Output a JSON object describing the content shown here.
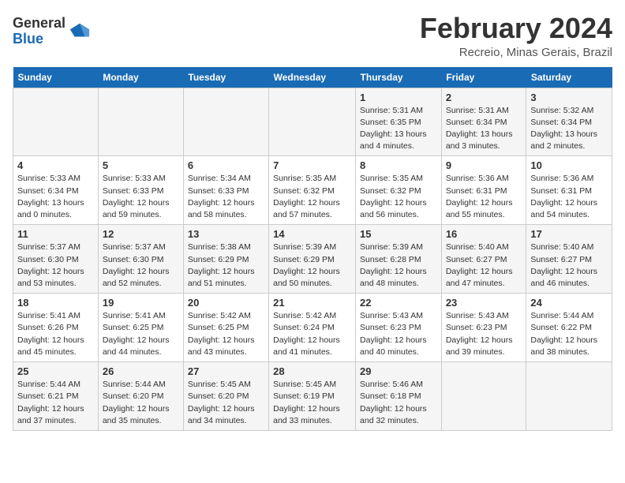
{
  "logo": {
    "general": "General",
    "blue": "Blue"
  },
  "header": {
    "month_year": "February 2024",
    "location": "Recreio, Minas Gerais, Brazil"
  },
  "days_of_week": [
    "Sunday",
    "Monday",
    "Tuesday",
    "Wednesday",
    "Thursday",
    "Friday",
    "Saturday"
  ],
  "weeks": [
    [
      {
        "day": "",
        "info": ""
      },
      {
        "day": "",
        "info": ""
      },
      {
        "day": "",
        "info": ""
      },
      {
        "day": "",
        "info": ""
      },
      {
        "day": "1",
        "info": "Sunrise: 5:31 AM\nSunset: 6:35 PM\nDaylight: 13 hours\nand 4 minutes."
      },
      {
        "day": "2",
        "info": "Sunrise: 5:31 AM\nSunset: 6:34 PM\nDaylight: 13 hours\nand 3 minutes."
      },
      {
        "day": "3",
        "info": "Sunrise: 5:32 AM\nSunset: 6:34 PM\nDaylight: 13 hours\nand 2 minutes."
      }
    ],
    [
      {
        "day": "4",
        "info": "Sunrise: 5:33 AM\nSunset: 6:34 PM\nDaylight: 13 hours\nand 0 minutes."
      },
      {
        "day": "5",
        "info": "Sunrise: 5:33 AM\nSunset: 6:33 PM\nDaylight: 12 hours\nand 59 minutes."
      },
      {
        "day": "6",
        "info": "Sunrise: 5:34 AM\nSunset: 6:33 PM\nDaylight: 12 hours\nand 58 minutes."
      },
      {
        "day": "7",
        "info": "Sunrise: 5:35 AM\nSunset: 6:32 PM\nDaylight: 12 hours\nand 57 minutes."
      },
      {
        "day": "8",
        "info": "Sunrise: 5:35 AM\nSunset: 6:32 PM\nDaylight: 12 hours\nand 56 minutes."
      },
      {
        "day": "9",
        "info": "Sunrise: 5:36 AM\nSunset: 6:31 PM\nDaylight: 12 hours\nand 55 minutes."
      },
      {
        "day": "10",
        "info": "Sunrise: 5:36 AM\nSunset: 6:31 PM\nDaylight: 12 hours\nand 54 minutes."
      }
    ],
    [
      {
        "day": "11",
        "info": "Sunrise: 5:37 AM\nSunset: 6:30 PM\nDaylight: 12 hours\nand 53 minutes."
      },
      {
        "day": "12",
        "info": "Sunrise: 5:37 AM\nSunset: 6:30 PM\nDaylight: 12 hours\nand 52 minutes."
      },
      {
        "day": "13",
        "info": "Sunrise: 5:38 AM\nSunset: 6:29 PM\nDaylight: 12 hours\nand 51 minutes."
      },
      {
        "day": "14",
        "info": "Sunrise: 5:39 AM\nSunset: 6:29 PM\nDaylight: 12 hours\nand 50 minutes."
      },
      {
        "day": "15",
        "info": "Sunrise: 5:39 AM\nSunset: 6:28 PM\nDaylight: 12 hours\nand 48 minutes."
      },
      {
        "day": "16",
        "info": "Sunrise: 5:40 AM\nSunset: 6:27 PM\nDaylight: 12 hours\nand 47 minutes."
      },
      {
        "day": "17",
        "info": "Sunrise: 5:40 AM\nSunset: 6:27 PM\nDaylight: 12 hours\nand 46 minutes."
      }
    ],
    [
      {
        "day": "18",
        "info": "Sunrise: 5:41 AM\nSunset: 6:26 PM\nDaylight: 12 hours\nand 45 minutes."
      },
      {
        "day": "19",
        "info": "Sunrise: 5:41 AM\nSunset: 6:25 PM\nDaylight: 12 hours\nand 44 minutes."
      },
      {
        "day": "20",
        "info": "Sunrise: 5:42 AM\nSunset: 6:25 PM\nDaylight: 12 hours\nand 43 minutes."
      },
      {
        "day": "21",
        "info": "Sunrise: 5:42 AM\nSunset: 6:24 PM\nDaylight: 12 hours\nand 41 minutes."
      },
      {
        "day": "22",
        "info": "Sunrise: 5:43 AM\nSunset: 6:23 PM\nDaylight: 12 hours\nand 40 minutes."
      },
      {
        "day": "23",
        "info": "Sunrise: 5:43 AM\nSunset: 6:23 PM\nDaylight: 12 hours\nand 39 minutes."
      },
      {
        "day": "24",
        "info": "Sunrise: 5:44 AM\nSunset: 6:22 PM\nDaylight: 12 hours\nand 38 minutes."
      }
    ],
    [
      {
        "day": "25",
        "info": "Sunrise: 5:44 AM\nSunset: 6:21 PM\nDaylight: 12 hours\nand 37 minutes."
      },
      {
        "day": "26",
        "info": "Sunrise: 5:44 AM\nSunset: 6:20 PM\nDaylight: 12 hours\nand 35 minutes."
      },
      {
        "day": "27",
        "info": "Sunrise: 5:45 AM\nSunset: 6:20 PM\nDaylight: 12 hours\nand 34 minutes."
      },
      {
        "day": "28",
        "info": "Sunrise: 5:45 AM\nSunset: 6:19 PM\nDaylight: 12 hours\nand 33 minutes."
      },
      {
        "day": "29",
        "info": "Sunrise: 5:46 AM\nSunset: 6:18 PM\nDaylight: 12 hours\nand 32 minutes."
      },
      {
        "day": "",
        "info": ""
      },
      {
        "day": "",
        "info": ""
      }
    ]
  ]
}
